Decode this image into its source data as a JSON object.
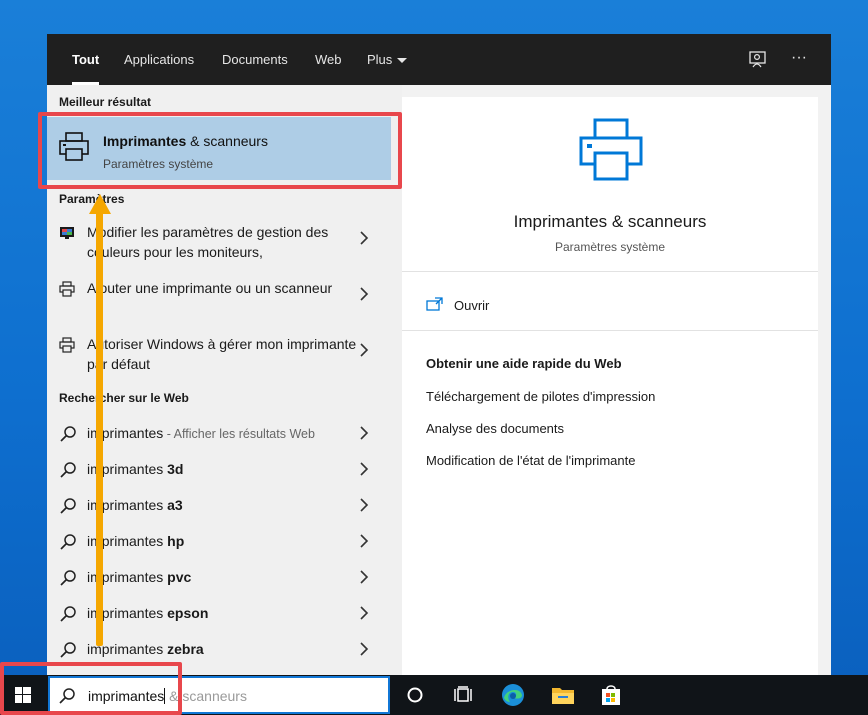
{
  "tabs": [
    {
      "label": "Tout",
      "active": true
    },
    {
      "label": "Applications",
      "active": false
    },
    {
      "label": "Documents",
      "active": false
    },
    {
      "label": "Web",
      "active": false
    },
    {
      "label": "Plus",
      "active": false
    }
  ],
  "top_icons": [
    "feedback-icon",
    "more-options-icon"
  ],
  "more_glyph": "···",
  "left": {
    "best_match_title": "Meilleur résultat",
    "best_match": {
      "name": "Imprimantes",
      "name_rest": " & scanneurs",
      "sub": "Paramètres système"
    },
    "settings_title": "Paramètres",
    "settings": [
      {
        "label": "Modifier les paramètres de gestion des couleurs pour les moniteurs,",
        "icon": "monitor-color-icon"
      },
      {
        "label": "Ajouter une imprimante ou un scanneur",
        "icon": "printer-icon"
      },
      {
        "label": "Autoriser Windows à gérer mon imprimante par défaut",
        "icon": "printer-icon"
      }
    ],
    "web_title": "Rechercher sur le Web",
    "web": [
      {
        "query": "imprimantes",
        "suffix": "",
        "hint": " - Afficher les résultats Web"
      },
      {
        "query": "imprimantes ",
        "suffix": "3d",
        "hint": ""
      },
      {
        "query": "imprimantes ",
        "suffix": "a3",
        "hint": ""
      },
      {
        "query": "imprimantes ",
        "suffix": "hp",
        "hint": ""
      },
      {
        "query": "imprimantes ",
        "suffix": "pvc",
        "hint": ""
      },
      {
        "query": "imprimantes ",
        "suffix": "epson",
        "hint": ""
      },
      {
        "query": "imprimantes ",
        "suffix": "zebra",
        "hint": ""
      }
    ]
  },
  "right": {
    "title": "Imprimantes & scanneurs",
    "sub": "Paramètres système",
    "open_label": "Ouvrir",
    "help_title": "Obtenir une aide rapide du Web",
    "help_links": [
      "Téléchargement de pilotes d'impression",
      "Analyse des documents",
      "Modification de l'état de l'imprimante"
    ]
  },
  "taskbar": {
    "typed": "imprimantes",
    "ghost": " & scanneurs",
    "icons": [
      "cortana-icon",
      "task-view-icon",
      "edge-icon",
      "file-explorer-icon",
      "store-icon"
    ]
  },
  "colors": {
    "accent": "#0078d7",
    "highlight_box": "#e8474c",
    "arrow": "#f5a700",
    "selected_row": "#aecde6"
  }
}
